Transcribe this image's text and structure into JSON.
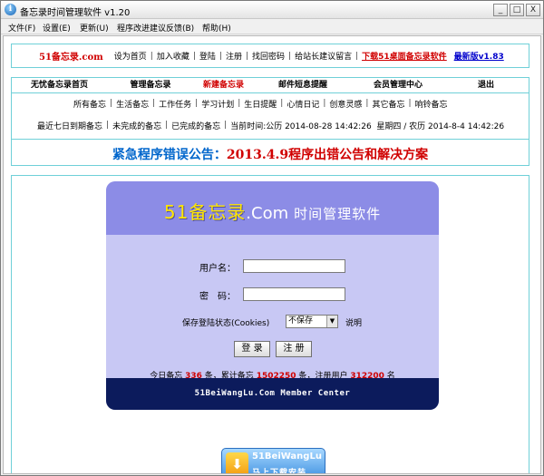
{
  "window": {
    "title": "备忘录时间管理软件 v1.20",
    "icon_glyph": "i",
    "minimize": "_",
    "maximize": "□",
    "close": "X"
  },
  "menu": [
    "文件(F)",
    "设置(E)",
    "更新(U)",
    "程序改进建议反馈(B)",
    "帮助(H)"
  ],
  "toplinks": {
    "logo": "51备忘录.com",
    "items": [
      "设为首页",
      "加入收藏",
      "登陆",
      "注册",
      "找回密码",
      "给站长建议留言"
    ],
    "download_text": "下载51桌面备忘录软件",
    "latest_text": "最新版v1.83"
  },
  "nav": [
    "无忧备忘录首页",
    "管理备忘录",
    "新建备忘录",
    "邮件短息提醒",
    "会员管理中心",
    "退出"
  ],
  "categories": [
    "所有备忘",
    "生活备忘",
    "工作任务",
    "学习计划",
    "生日提醒",
    "心情日记",
    "创意灵感",
    "其它备忘",
    "响铃备忘"
  ],
  "status": {
    "items": [
      "最近七日到期备忘",
      "未完成的备忘",
      "已完成的备忘"
    ],
    "time": "当前时间:公历 2014-08-28 14:42:26  星期四 / 农历 2014-8-4 14:42:26"
  },
  "announcement": {
    "prefix": "紧急程序错误公告：",
    "text": "2013.4.9程序出错公告和解决方案"
  },
  "login": {
    "title_a": "51备忘录",
    "title_b": ".Com",
    "title_c": "时间管理软件",
    "username_label": "用户名：",
    "username_value": "",
    "password_label": "密　码：",
    "password_value": "",
    "remember_label": "保存登陆状态(Cookies)",
    "remember_value": "不保存",
    "explain": "说明",
    "login_button": "登 录",
    "register_button": "注 册",
    "stats": {
      "today_label": "今日备忘",
      "today_value": "336",
      "unit": "条",
      "total_label": "累计备忘",
      "total_value": "1502250",
      "users_label": "注册用户",
      "users_value": "312200",
      "users_unit": "名"
    },
    "footer": "51BeiWangLu.Com Member Center"
  },
  "badge": {
    "line1": "51BeiWangLu",
    "line2": "马上下载安装"
  },
  "colors": {
    "accent_red": "#d00000",
    "accent_blue": "#0066cc",
    "panel_head": "#8c8ce6",
    "panel_body": "#c8c8f4",
    "panel_foot": "#0c1b5c",
    "border_teal": "#6fd0d8"
  }
}
